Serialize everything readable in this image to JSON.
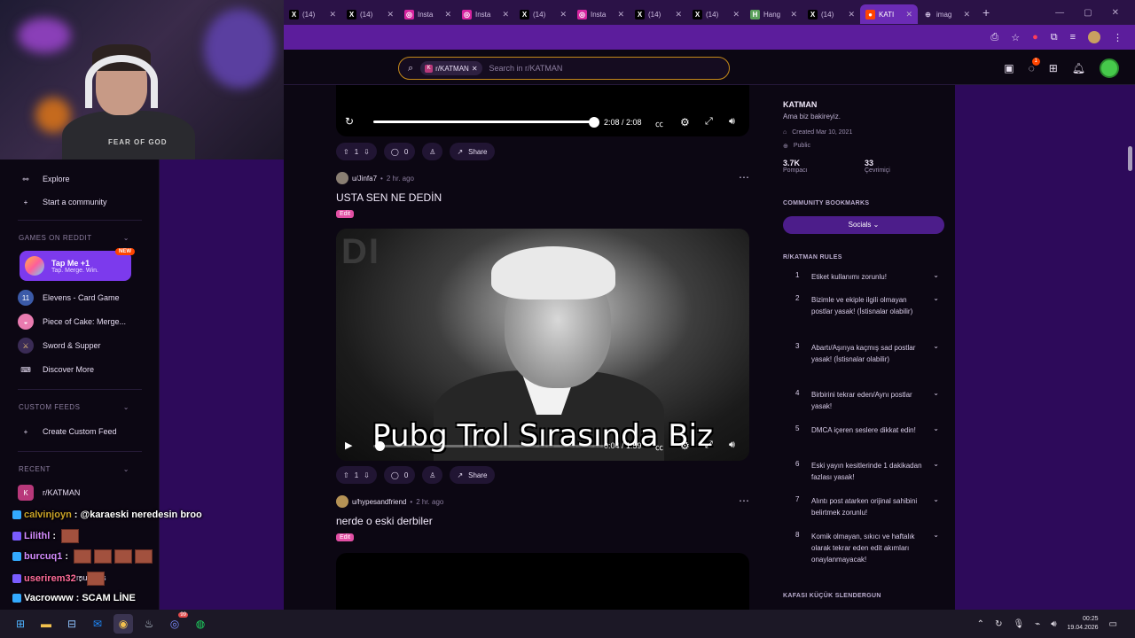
{
  "browser": {
    "tabs": [
      {
        "label": "(14)",
        "icon": "x-icon"
      },
      {
        "label": "(14)",
        "icon": "x-icon"
      },
      {
        "label": "Insta",
        "icon": "instagram-icon"
      },
      {
        "label": "Insta",
        "icon": "instagram-icon"
      },
      {
        "label": "(14)",
        "icon": "x-icon"
      },
      {
        "label": "Insta",
        "icon": "instagram-icon"
      },
      {
        "label": "(14)",
        "icon": "x-icon"
      },
      {
        "label": "(14)",
        "icon": "x-icon"
      },
      {
        "label": "Hang",
        "icon": "hang-icon"
      },
      {
        "label": "(14)",
        "icon": "x-icon"
      },
      {
        "label": "KATI",
        "icon": "reddit-icon",
        "active": true
      },
      {
        "label": "imag",
        "icon": "globe-icon"
      }
    ],
    "accent": "#5c1d9c"
  },
  "header": {
    "search_chip": "r/KATMAN",
    "search_placeholder": "Search in r/KATMAN",
    "notification_badge": "1"
  },
  "sidebar": {
    "explore": "Explore",
    "start_community": "Start a community",
    "games_heading": "GAMES ON REDDIT",
    "tapme_title": "Tap Me +1",
    "tapme_sub": "Tap. Merge. Win.",
    "new_badge": "NEW",
    "games": [
      "Elevens - Card Game",
      "Piece of Cake: Merge...",
      "Sword & Supper",
      "Discover More"
    ],
    "custom_feeds_heading": "CUSTOM FEEDS",
    "create_feed": "Create Custom Feed",
    "recent_heading": "RECENT",
    "recent_item": "r/KATMAN"
  },
  "chat": [
    {
      "user": "calvinjoyn",
      "sep": " : ",
      "msg": "@karaeski neredesin broo",
      "color": "#c9a227"
    },
    {
      "user": "Lilithl",
      "sep": " : ",
      "msg": "",
      "color": "#d58cff"
    },
    {
      "user": "burcuq1",
      "sep": " : ",
      "msg": "",
      "color": "#d58cff"
    },
    {
      "user": "userirem32",
      "sep": " : ",
      "msg": "",
      "color": "#ff6b9a"
    },
    {
      "user": "Vacrowww",
      "sep": " : ",
      "msg": "SCAM LİNE",
      "color": "#ffffff"
    }
  ],
  "chat_overlay_text": "munities",
  "feed": {
    "top_video_time": "2:08 / 2:08",
    "post1": {
      "votes": "1",
      "comments": "0",
      "share": "Share"
    },
    "post2": {
      "user": "u/Jinfa7",
      "time": "2 hr. ago",
      "title": "USTA SEN NE DEDİN",
      "flair": "Edit",
      "caption": "Pubg Trol Sırasında Biz",
      "video_time": "0:04 / 1:59",
      "votes": "1",
      "comments": "0",
      "share": "Share"
    },
    "post3": {
      "user": "u/hypesandfriend",
      "time": "2 hr. ago",
      "title": "nerde o eski derbiler",
      "flair": "Edit"
    }
  },
  "community": {
    "name": "KATMAN",
    "tagline": "Ama biz bakireyiz.",
    "created": "Created Mar 10, 2021",
    "visibility": "Public",
    "members": "3.7K",
    "members_label": "Pompacı",
    "online": "33",
    "online_label": "Çevrimiçi",
    "bookmarks_heading": "COMMUNITY BOOKMARKS",
    "socials": "Socials",
    "rules_heading": "R/KATMAN RULES",
    "rules": [
      {
        "n": "1",
        "t": "Etiket kullanımı zorunlu!"
      },
      {
        "n": "2",
        "t": "Bizimle ve ekiple ilgili olmayan postlar yasak! (İstisnalar olabilir)"
      },
      {
        "n": "3",
        "t": "Abartı/Aşırıya kaçmış sad postlar yasak! (İstisnalar olabilir)"
      },
      {
        "n": "4",
        "t": "Birbirini tekrar eden/Aynı postlar yasak!"
      },
      {
        "n": "5",
        "t": "DMCA içeren seslere dikkat edin!"
      },
      {
        "n": "6",
        "t": "Eski yayın kesitlerinde 1 dakikadan fazlası yasak!"
      },
      {
        "n": "7",
        "t": "Alıntı post atarken orijinal sahibini belirtmek zorunlu!"
      },
      {
        "n": "8",
        "t": "Komik olmayan, sıkıcı ve haftalık olarak tekrar eden edit akımları onaylanmayacak!"
      }
    ],
    "footer_heading": "KAFASI KÜÇÜK SLENDERGUN"
  },
  "webcam": {
    "shirt": "FEAR OF GOD"
  },
  "taskbar": {
    "time": "00:25",
    "date": "19.04.2026",
    "discord_badge": "99"
  }
}
